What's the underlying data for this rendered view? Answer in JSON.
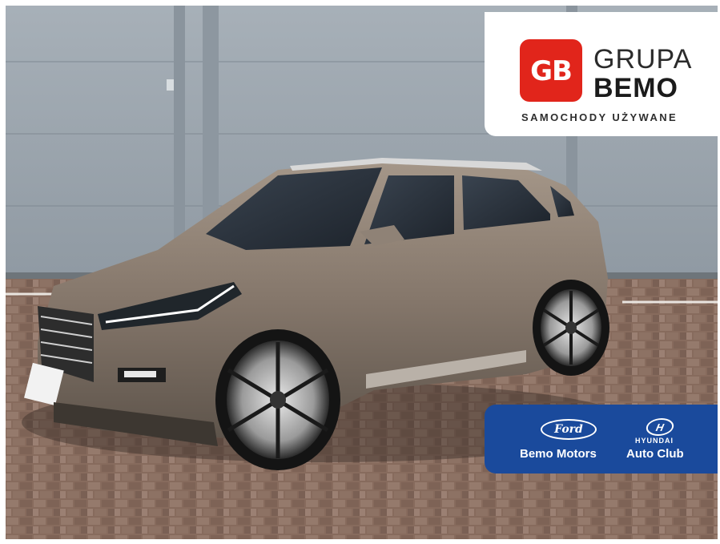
{
  "photo": {
    "subject": "car-photo",
    "car_color": "#8a7c70",
    "wall_color": "#9aa4ad",
    "ground_color": "#8a6f60"
  },
  "logo": {
    "badge": "GB",
    "line1": "GRUPA",
    "line2": "BEMO",
    "tagline": "SAMOCHODY UŻYWANE",
    "accent": "#e1251b"
  },
  "dealers": {
    "ford_logo": "Ford",
    "hyundai_word": "HYUNDAI",
    "dealer_a": "Bemo Motors",
    "dealer_b": "Auto Club",
    "bar_color": "#1a4a9c"
  }
}
